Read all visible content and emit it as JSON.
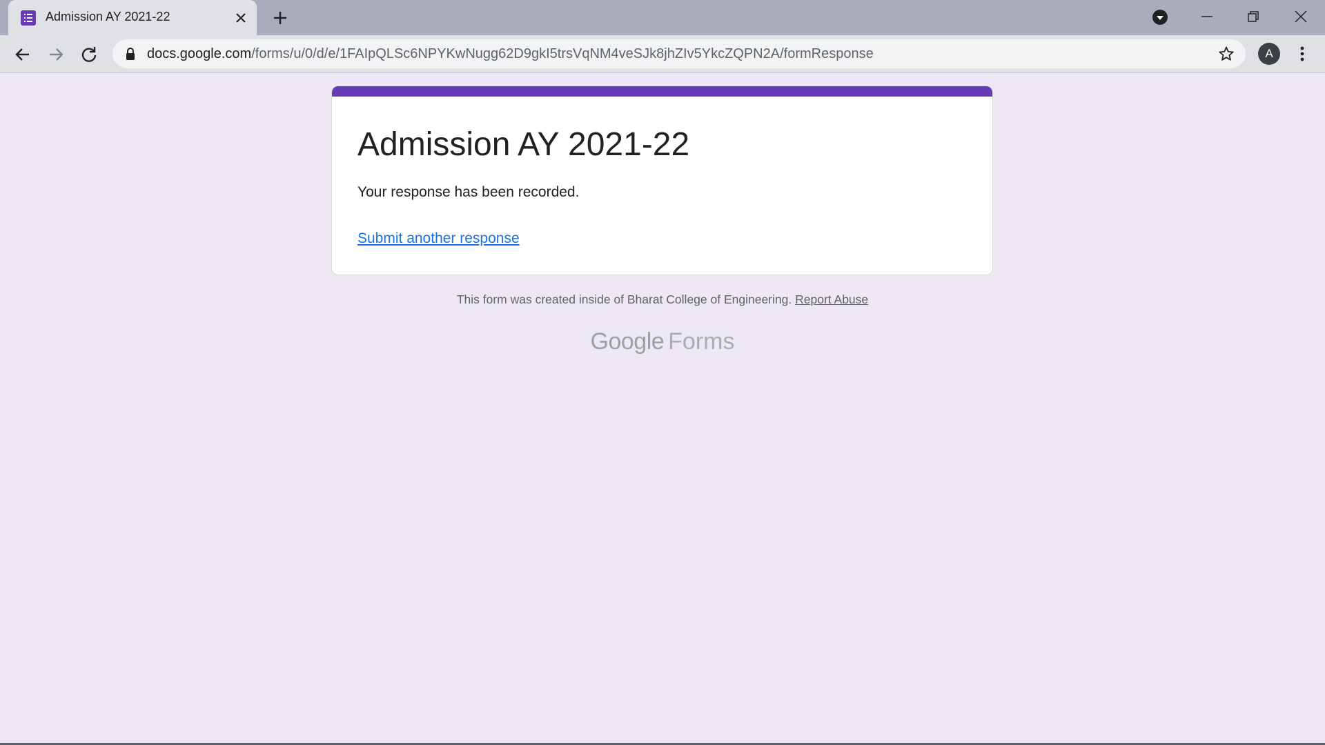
{
  "browser": {
    "tab_title": "Admission AY 2021-22",
    "url_host": "docs.google.com",
    "url_path": "/forms/u/0/d/e/1FAIpQLSc6NPYKwNugg62D9gkI5trsVqNM4veSJk8jhZIv5YkcZQPN2A/formResponse",
    "profile_initial": "A"
  },
  "form": {
    "title": "Admission AY 2021-22",
    "confirmation": "Your response has been recorded.",
    "submit_another": "Submit another response"
  },
  "footer": {
    "created_note": "This form was created inside of Bharat College of Engineering.",
    "report_abuse": "Report Abuse",
    "brand_google": "Google",
    "brand_forms": "Forms"
  },
  "colors": {
    "accent": "#673ab7",
    "page_background": "#ede7f6",
    "link": "#1a73e8"
  }
}
